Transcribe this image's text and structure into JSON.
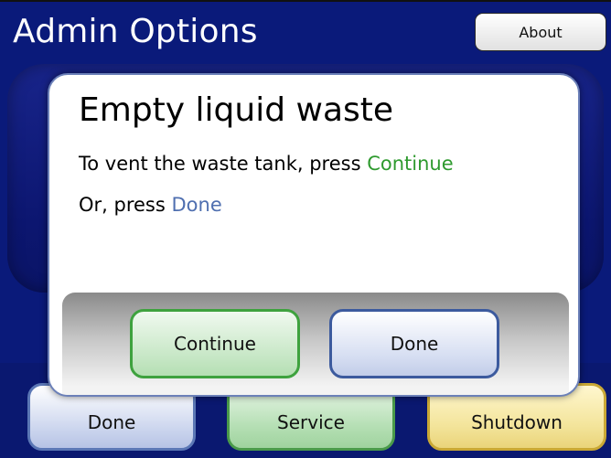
{
  "header": {
    "title": "Admin Options",
    "about_label": "About"
  },
  "bottom_buttons": {
    "done_label": "Done",
    "service_label": "Service",
    "shutdown_label": "Shutdown"
  },
  "dialog": {
    "title": "Empty liquid waste",
    "line1_prefix": "To vent the waste tank, press ",
    "line1_highlight": "Continue",
    "line2_prefix": "Or, press ",
    "line2_highlight": "Done",
    "continue_label": "Continue",
    "done_label": "Done"
  },
  "colors": {
    "background": "#0a1a7a",
    "continue_accent": "#2e9a2e",
    "done_accent": "#4f6fb0",
    "shutdown_accent": "#c9a835"
  }
}
